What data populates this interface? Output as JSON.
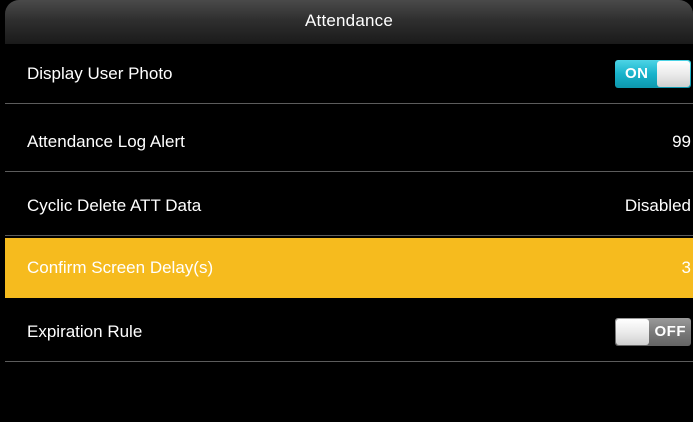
{
  "header": {
    "title": "Attendance"
  },
  "settings": [
    {
      "label": "Display User Photo",
      "type": "toggle",
      "state": "ON"
    },
    {
      "label": "Attendance Log Alert",
      "type": "value",
      "value": "99"
    },
    {
      "label": "Cyclic Delete ATT Data",
      "type": "value",
      "value": "Disabled"
    },
    {
      "label": "Confirm Screen Delay(s)",
      "type": "value",
      "value": "3",
      "selected": true
    },
    {
      "label": "Expiration Rule",
      "type": "toggle",
      "state": "OFF"
    }
  ],
  "colors": {
    "background": "#000000",
    "selected_row": "#f6bb1e",
    "toggle_on": "#18b3cb",
    "toggle_off": "#7a7a7a",
    "text": "#ffffff",
    "divider": "#5c5c5c"
  },
  "icons": {
    "toggle_on": "toggle-switch-on",
    "toggle_off": "toggle-switch-off"
  }
}
